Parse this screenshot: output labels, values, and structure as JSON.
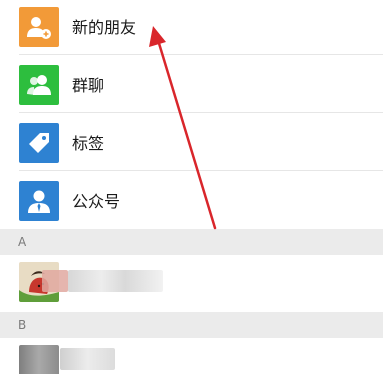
{
  "menu": {
    "items": [
      {
        "label": "新的朋友",
        "icon": "add-friend-icon",
        "color": "#f29a38"
      },
      {
        "label": "群聊",
        "icon": "group-chat-icon",
        "color": "#2dbe3e"
      },
      {
        "label": "标签",
        "icon": "tag-icon",
        "color": "#2e82d2"
      },
      {
        "label": "公众号",
        "icon": "official-account-icon",
        "color": "#2e82d2"
      }
    ]
  },
  "sections": [
    {
      "letter": "A"
    },
    {
      "letter": "B"
    }
  ],
  "annotation": {
    "color": "#d9262b",
    "icon": "red-arrow-annotation"
  }
}
